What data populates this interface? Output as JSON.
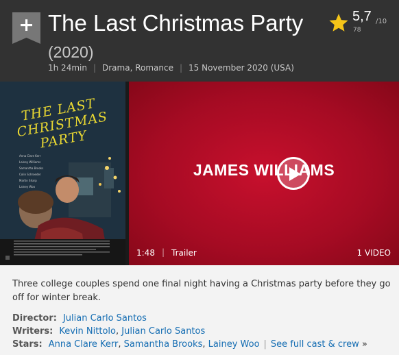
{
  "title": {
    "name": "The Last Christmas Party",
    "year": "(2020)",
    "runtime": "1h 24min",
    "genres": "Drama, Romance",
    "release_date": "15 November 2020 (USA)",
    "separator": "|"
  },
  "watchlist": {
    "symbol": "+"
  },
  "rating": {
    "value": "5,7",
    "max": "/10",
    "count": "78"
  },
  "poster": {
    "title_line1": "THE LAST",
    "title_line2": "CHRISTMAS",
    "title_line3": "PARTY",
    "cast": [
      "Anna Clare Kerr",
      "Lainey Williams",
      "Samantha Brooks",
      "Colin Schroeder",
      "Martin Sharp",
      "Lainey Woo"
    ]
  },
  "trailer": {
    "brand": "JAMES WILLIAMS",
    "duration": "1:48",
    "separator": "|",
    "label": "Trailer",
    "video_count": "1 VIDEO"
  },
  "summary": "Three college couples spend one final night having a Christmas party before they go off for winter break.",
  "credits": {
    "director_label": "Director:",
    "director": "Julian Carlo Santos",
    "writers_label": "Writers:",
    "writer_1": "Kevin Nittolo",
    "writer_sep": ",",
    "writer_2": "Julian Carlo Santos",
    "stars_label": "Stars:",
    "star_1": "Anna Clare Kerr",
    "star_2": "Samantha Brooks",
    "star_3": "Lainey Woo",
    "star_sep": ",",
    "bar": "|",
    "full_cast_link": "See full cast & crew",
    "full_cast_arrow": "»"
  },
  "colors": {
    "header_bg": "#323232",
    "star": "#f5c518",
    "link": "#136cb2",
    "trailer_red": "#c7102d"
  }
}
